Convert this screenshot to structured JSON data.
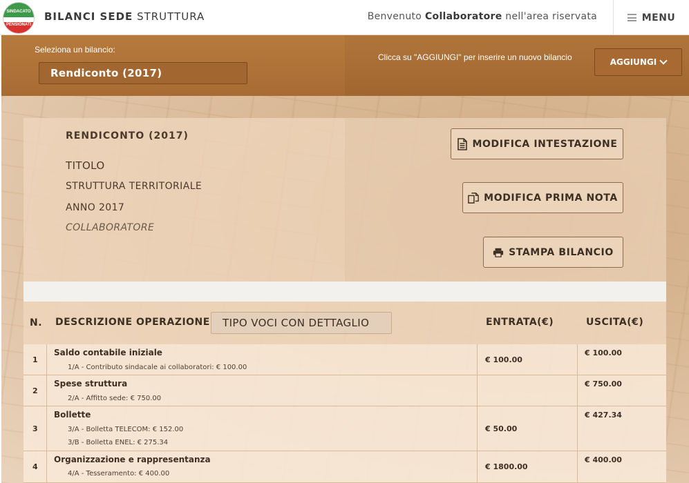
{
  "header": {
    "logo_top_text": "SINDACATO",
    "logo_bottom_text": "PENSIONATI",
    "title_bold": "BILANCI SEDE",
    "title_light": "STRUTTURA",
    "welcome_pre": "Benvenuto",
    "welcome_user": "Collaboratore",
    "welcome_post": "nell'area riservata",
    "menu_label": "MENU"
  },
  "selector": {
    "label": "Seleziona un bilancio:",
    "selected": "Rendiconto (2017)",
    "hint": "Clicca su \"AGGIUNGI\" per inserire un nuovo bilancio",
    "add_label": "AGGIUNGI"
  },
  "card": {
    "heading": "RENDICONTO (2017)",
    "title": "TITOLO",
    "structure": "STRUTTURA TERRITORIALE",
    "year": "ANNO 2017",
    "collaborator": "COLLABORATORE",
    "btn_edit_header": "MODIFICA INTESTAZIONE",
    "btn_edit_note": "MODIFICA PRIMA NOTA",
    "btn_print": "STAMPA BILANCIO"
  },
  "table": {
    "col_n": "N.",
    "col_desc": "DESCRIZIONE OPERAZIONE",
    "type_select": "TIPO VOCI CON DETTAGLIO",
    "col_in": "ENTRATA(€)",
    "col_out": "USCITA(€)",
    "rows": [
      {
        "n": "1",
        "desc": "Saldo contabile iniziale",
        "details": [
          "1/A - Contributo sindacale ai collaboratori: € 100.00"
        ],
        "in": "€ 100.00",
        "out": "€ 100.00"
      },
      {
        "n": "2",
        "desc": "Spese struttura",
        "details": [
          "2/A - Affitto sede: € 750.00"
        ],
        "in": "",
        "out": "€ 750.00"
      },
      {
        "n": "3",
        "desc": "Bollette",
        "details": [
          "3/A - Bolletta TELECOM: € 152.00",
          "3/B - Bolletta ENEL: € 275.34"
        ],
        "in": "€ 50.00",
        "out": "€ 427.34"
      },
      {
        "n": "4",
        "desc": "Organizzazione e rappresentanza",
        "details": [
          "4/A - Tesseramento: € 400.00"
        ],
        "in": "€ 1800.00",
        "out": "€ 400.00"
      }
    ]
  }
}
